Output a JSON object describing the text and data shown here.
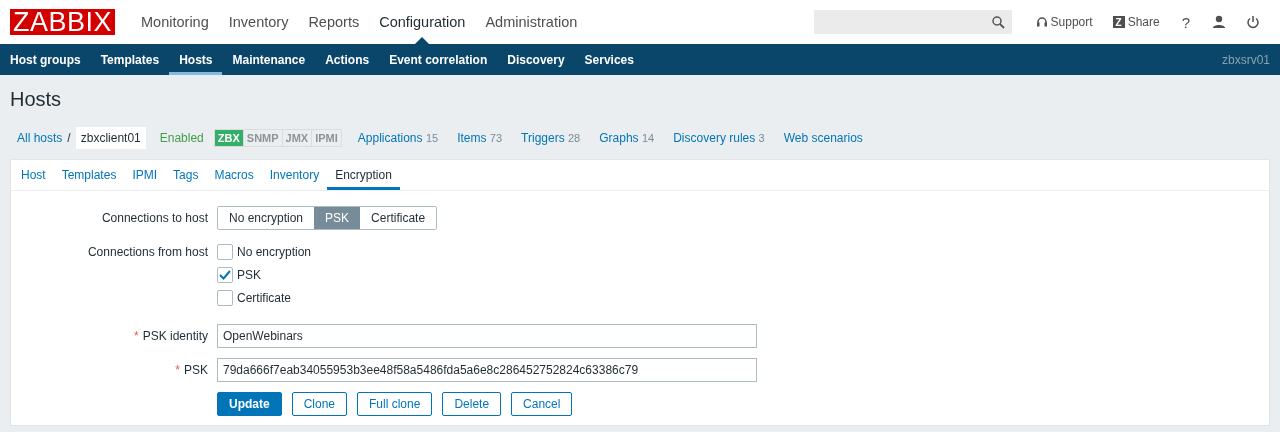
{
  "logo": "ZABBIX",
  "top_menu": [
    {
      "label": "Monitoring",
      "selected": false
    },
    {
      "label": "Inventory",
      "selected": false
    },
    {
      "label": "Reports",
      "selected": false
    },
    {
      "label": "Configuration",
      "selected": true
    },
    {
      "label": "Administration",
      "selected": false
    }
  ],
  "header_links": [
    {
      "kind": "support",
      "label": "Support"
    },
    {
      "kind": "share",
      "label": "Share",
      "icon_letter": "Z"
    },
    {
      "kind": "help",
      "label": "?"
    },
    {
      "kind": "user"
    },
    {
      "kind": "logout"
    }
  ],
  "sub_menu": [
    {
      "label": "Host groups",
      "selected": false
    },
    {
      "label": "Templates",
      "selected": false
    },
    {
      "label": "Hosts",
      "selected": true
    },
    {
      "label": "Maintenance",
      "selected": false
    },
    {
      "label": "Actions",
      "selected": false
    },
    {
      "label": "Event correlation",
      "selected": false
    },
    {
      "label": "Discovery",
      "selected": false
    },
    {
      "label": "Services",
      "selected": false
    }
  ],
  "server_name": "zbxsrv01",
  "page_title": "Hosts",
  "breadcrumb": {
    "root": "All hosts",
    "separator": "/",
    "current": "zbxclient01"
  },
  "status": "Enabled",
  "interfaces": [
    {
      "label": "ZBX",
      "available": true
    },
    {
      "label": "SNMP",
      "available": false
    },
    {
      "label": "JMX",
      "available": false
    },
    {
      "label": "IPMI",
      "available": false
    }
  ],
  "host_links": [
    {
      "label": "Applications",
      "count": "15"
    },
    {
      "label": "Items",
      "count": "73"
    },
    {
      "label": "Triggers",
      "count": "28"
    },
    {
      "label": "Graphs",
      "count": "14"
    },
    {
      "label": "Discovery rules",
      "count": "3"
    },
    {
      "label": "Web scenarios"
    }
  ],
  "tabs": [
    {
      "label": "Host",
      "selected": false
    },
    {
      "label": "Templates",
      "selected": false
    },
    {
      "label": "IPMI",
      "selected": false
    },
    {
      "label": "Tags",
      "selected": false
    },
    {
      "label": "Macros",
      "selected": false
    },
    {
      "label": "Inventory",
      "selected": false
    },
    {
      "label": "Encryption",
      "selected": true
    }
  ],
  "connections_to_host": {
    "label": "Connections to host",
    "options": [
      {
        "label": "No encryption",
        "selected": false
      },
      {
        "label": "PSK",
        "selected": true
      },
      {
        "label": "Certificate",
        "selected": false
      }
    ]
  },
  "connections_from_host": {
    "label": "Connections from host",
    "options": [
      {
        "label": "No encryption",
        "checked": false
      },
      {
        "label": "PSK",
        "checked": true
      },
      {
        "label": "Certificate",
        "checked": false
      }
    ]
  },
  "fields": [
    {
      "label": "PSK identity",
      "required_mark": "*",
      "value": "OpenWebinars"
    },
    {
      "label": "PSK",
      "required_mark": "*",
      "value": "79da666f7eab34055953b3ee48f58a5486fda5a6e8c286452752824c63386c79"
    }
  ],
  "buttons": [
    {
      "label": "Update",
      "primary": true
    },
    {
      "label": "Clone",
      "primary": false
    },
    {
      "label": "Full clone",
      "primary": false
    },
    {
      "label": "Delete",
      "primary": false
    },
    {
      "label": "Cancel",
      "primary": false
    }
  ]
}
